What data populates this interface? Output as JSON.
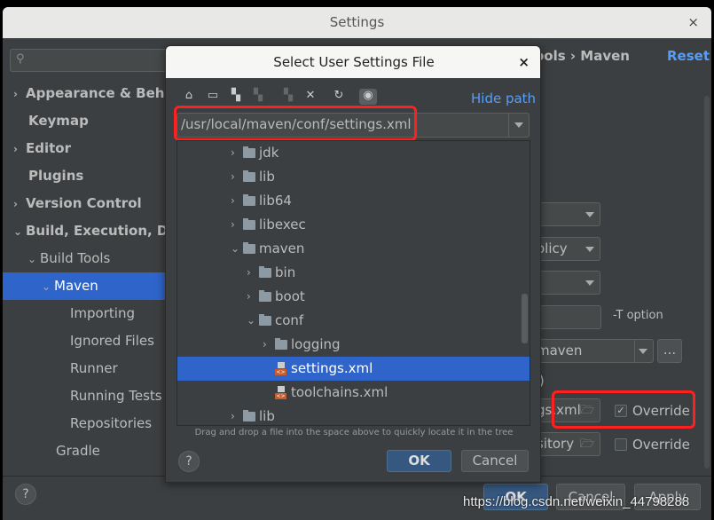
{
  "window": {
    "title": "Settings",
    "close": "×"
  },
  "sidebar": {
    "items": [
      {
        "label": "Appearance & Behavior",
        "arrow": "›"
      },
      {
        "label": "Keymap"
      },
      {
        "label": "Editor",
        "arrow": "›"
      },
      {
        "label": "Plugins"
      },
      {
        "label": "Version Control",
        "arrow": "›"
      },
      {
        "label": "Build, Execution, Deployment",
        "arrow": "⌄"
      },
      {
        "label": "Build Tools",
        "arrow": "⌄"
      },
      {
        "label": "Maven",
        "arrow": "⌄",
        "selected": true
      },
      {
        "label": "Importing"
      },
      {
        "label": "Ignored Files"
      },
      {
        "label": "Runner"
      },
      {
        "label": "Running Tests"
      },
      {
        "label": "Repositories"
      },
      {
        "label": "Gradle"
      }
    ]
  },
  "main": {
    "breadcrumb": "Build, Execution, Deployment › Build Tools › Maven",
    "breadcrumb_visible": "ools › Maven",
    "reset": "Reset",
    "policy_visible": "olicy",
    "thread_suffix": "-T option",
    "home_visible": "maven",
    "browse": "...",
    "bundled_visible": "s)",
    "user_settings_visible": "gs.xml",
    "local_repo_visible": "sitory",
    "override_settings": {
      "label": "Override",
      "checked": true
    },
    "override_repo": {
      "label": "Override",
      "checked": false
    }
  },
  "footer": {
    "help": "?",
    "ok": "OK",
    "cancel": "Cancel",
    "apply": "Apply"
  },
  "dialog": {
    "title": "Select User Settings File",
    "close": "×",
    "toolbar": [
      "home-icon",
      "desktop-icon",
      "new-folder-icon",
      "project-folder-icon",
      "module-folder-icon",
      "delete-icon",
      "refresh-icon",
      "show-hidden-icon"
    ],
    "hide_path": "Hide path",
    "path": "/usr/local/maven/conf/settings.xml",
    "tree": [
      {
        "label": "jdk",
        "type": "folder",
        "depth": 0,
        "arrow": "›"
      },
      {
        "label": "lib",
        "type": "folder",
        "depth": 0,
        "arrow": "›"
      },
      {
        "label": "lib64",
        "type": "folder",
        "depth": 0,
        "arrow": "›"
      },
      {
        "label": "libexec",
        "type": "folder",
        "depth": 0,
        "arrow": "›"
      },
      {
        "label": "maven",
        "type": "folder",
        "depth": 0,
        "arrow": "⌄"
      },
      {
        "label": "bin",
        "type": "folder",
        "depth": 1,
        "arrow": "›"
      },
      {
        "label": "boot",
        "type": "folder",
        "depth": 1,
        "arrow": "›"
      },
      {
        "label": "conf",
        "type": "folder",
        "depth": 1,
        "arrow": "⌄"
      },
      {
        "label": "logging",
        "type": "folder",
        "depth": 2,
        "arrow": "›"
      },
      {
        "label": "settings.xml",
        "type": "xml",
        "depth": 2,
        "selected": true
      },
      {
        "label": "toolchains.xml",
        "type": "xml",
        "depth": 2
      },
      {
        "label": "lib",
        "type": "folder",
        "depth": 0,
        "arrow": "›"
      }
    ],
    "hint": "Drag and drop a file into the space above to quickly locate it in the tree",
    "help": "?",
    "ok": "OK",
    "cancel": "Cancel"
  },
  "watermark": "https://blog.csdn.net/weixin_44798288",
  "colors": {
    "selection": "#2f65ca",
    "link": "#589df6",
    "highlight": "#ff2020"
  }
}
